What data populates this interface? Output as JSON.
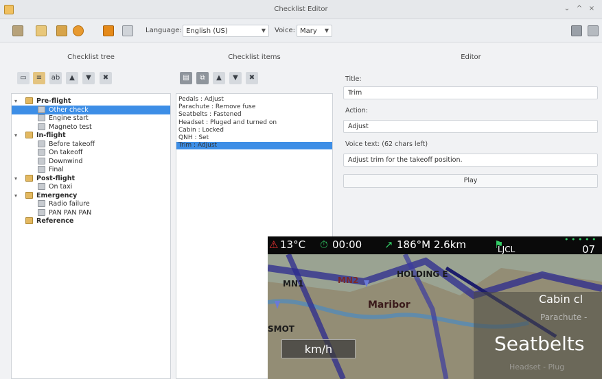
{
  "window": {
    "title": "Checklist Editor",
    "controls": [
      "⌄",
      "^",
      "×"
    ]
  },
  "toolbar": {
    "language_label": "Language:",
    "language_value": "English (US)",
    "voice_label": "Voice:",
    "voice_value": "Mary"
  },
  "tree_pane": {
    "header": "Checklist tree",
    "buttons": [
      "add-group",
      "add-item",
      "rename",
      "up",
      "down",
      "delete"
    ],
    "groups": [
      {
        "label": "Pre-flight",
        "expanded": true,
        "items": [
          "Other check",
          "Engine start",
          "Magneto test"
        ]
      },
      {
        "label": "In-flight",
        "expanded": true,
        "items": [
          "Before takeoff",
          "On takeoff",
          "Downwind",
          "Final"
        ]
      },
      {
        "label": "Post-flight",
        "expanded": true,
        "items": [
          "On taxi"
        ]
      },
      {
        "label": "Emergency",
        "expanded": true,
        "items": [
          "Radio failure",
          "PAN PAN PAN"
        ]
      },
      {
        "label": "Reference",
        "expanded": false,
        "items": []
      }
    ],
    "selected": "Other check"
  },
  "items_pane": {
    "header": "Checklist items",
    "items": [
      "Pedals : Adjust",
      "Parachute : Remove fuse",
      "Seatbelts : Fastened",
      "Headset : Pluged and turned on",
      "Cabin : Locked",
      "QNH : Set",
      "Trim : Adjust"
    ],
    "selected_index": 6
  },
  "editor": {
    "header": "Editor",
    "title_label": "Title:",
    "title_value": "Trim",
    "action_label": "Action:",
    "action_value": "Adjust",
    "voice_label": "Voice text: (62 chars left)",
    "voice_value": "Adjust trim for the takeoff position.",
    "play_label": "Play"
  },
  "overlay": {
    "temp": "13°C",
    "timer": "00:00",
    "heading": "186°M 2.6km",
    "airport": "LJCL",
    "time_partial": "07",
    "map_labels": [
      "MN1",
      "MN2",
      "HOLDING E",
      "Maribor",
      "SMOT"
    ],
    "speed_unit": "km/h",
    "checklist_title": "Cabin cl",
    "checklist_prev": "Parachute -",
    "checklist_current": "Seatbelts",
    "checklist_next": "Headset - Plug"
  }
}
